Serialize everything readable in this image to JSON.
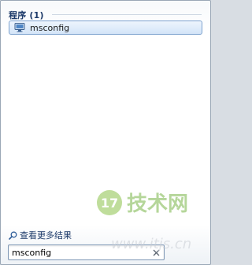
{
  "results": {
    "header": "程序 (1)",
    "items": [
      {
        "label": "msconfig",
        "icon": "monitor-icon"
      }
    ]
  },
  "footer": {
    "see_more": "查看更多结果",
    "search_value": "msconfig",
    "clear_icon": "clear-icon"
  },
  "watermark": {
    "logo_text": "17",
    "site_name": "技术网",
    "url": "www.itjs.cn"
  },
  "colors": {
    "header": "#1e3b6a",
    "selection_border": "#7da2ce",
    "selection_fill": "#d3e4f8",
    "watermark_green": "#8bc34a"
  }
}
